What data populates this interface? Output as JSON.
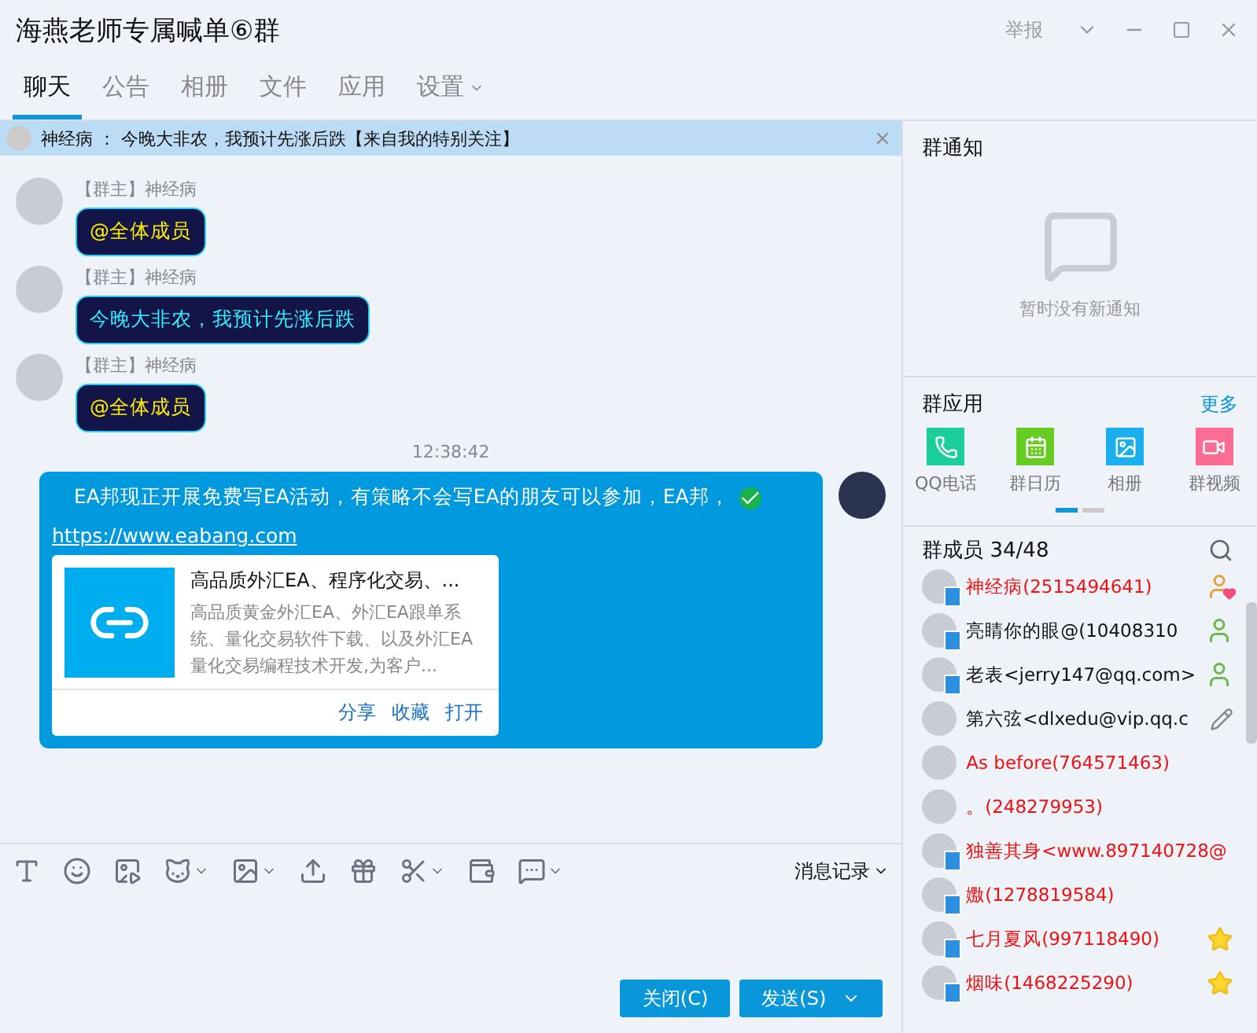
{
  "window": {
    "title": "海燕老师专属喊单⑥群",
    "report": "举报"
  },
  "tabs": [
    {
      "label": "聊天",
      "selected": true,
      "dropdown": false
    },
    {
      "label": "公告",
      "selected": false,
      "dropdown": false
    },
    {
      "label": "相册",
      "selected": false,
      "dropdown": false
    },
    {
      "label": "文件",
      "selected": false,
      "dropdown": false
    },
    {
      "label": "应用",
      "selected": false,
      "dropdown": false
    },
    {
      "label": "设置",
      "selected": false,
      "dropdown": true
    }
  ],
  "banner": {
    "sender": "神经病",
    "separator": "：",
    "text": "今晚大非农，我预计先涨后跌【来自我的特别关注】"
  },
  "messages": [
    {
      "kind": "incoming",
      "role": "【群主】",
      "name": "神经病",
      "text": "@全体成员",
      "mention": true
    },
    {
      "kind": "incoming",
      "role": "【群主】",
      "name": "神经病",
      "text": "今晚大非农，我预计先涨后跌",
      "mention": false
    },
    {
      "kind": "incoming",
      "role": "【群主】",
      "name": "神经病",
      "text": "@全体成员",
      "mention": true
    },
    {
      "kind": "time",
      "text": "12:38:42"
    },
    {
      "kind": "outgoing",
      "text": "EA邦现正开展免费写EA活动，有策略不会写EA的朋友可以参加，EA邦，",
      "link": "https://www.eabang.com",
      "card": {
        "title": "高品质外汇EA、程序化交易、...",
        "description": "高品质黄金外汇EA、外汇EA跟单系统、量化交易软件下载、以及外汇EA量化交易编程技术开发,为客户...",
        "actions": [
          "分享",
          "收藏",
          "打开"
        ]
      }
    }
  ],
  "toolbar": {
    "history": "消息记录"
  },
  "buttons": {
    "close": "关闭(C)",
    "send": "发送(S)"
  },
  "notice": {
    "title": "群通知",
    "empty": "暂时没有新通知"
  },
  "apps": {
    "title": "群应用",
    "more": "更多",
    "items": [
      {
        "kind": "phone",
        "label": "QQ电话",
        "color": "#1ccf9a"
      },
      {
        "kind": "calendar",
        "label": "群日历",
        "color": "#66cc22"
      },
      {
        "kind": "album",
        "label": "相册",
        "color": "#1ab0f0"
      },
      {
        "kind": "video",
        "label": "群视频",
        "color": "#fb6b93"
      }
    ],
    "pages": [
      {
        "selected": true
      },
      {
        "selected": false
      }
    ]
  },
  "members": {
    "title": "群成员 34/48",
    "items": [
      {
        "kind": "owner",
        "name": "神经病(2515494641)",
        "highlighted": true,
        "mobile": true
      },
      {
        "kind": "admin",
        "name": "亮睛你的眼@(10408310",
        "highlighted": false,
        "mobile": true
      },
      {
        "kind": "admin",
        "name": "老表<jerry147@qq.com>",
        "highlighted": false,
        "mobile": true
      },
      {
        "kind": "editor",
        "name": "第六弦<dlxedu@vip.qq.c",
        "highlighted": false,
        "mobile": false
      },
      {
        "kind": "plain",
        "name": "As before(764571463)",
        "highlighted": true,
        "mobile": false
      },
      {
        "kind": "plain",
        "name": "。(248279953)",
        "highlighted": true,
        "mobile": false
      },
      {
        "kind": "plain",
        "name": "独善其身<www.897140728@",
        "highlighted": true,
        "mobile": true
      },
      {
        "kind": "plain",
        "name": "嫐(1278819584)",
        "highlighted": true,
        "mobile": true
      },
      {
        "kind": "star",
        "name": "七月夏风(997118490)",
        "highlighted": true,
        "mobile": true
      },
      {
        "kind": "star",
        "name": "烟味(1468225290)",
        "highlighted": true,
        "mobile": true
      }
    ]
  }
}
